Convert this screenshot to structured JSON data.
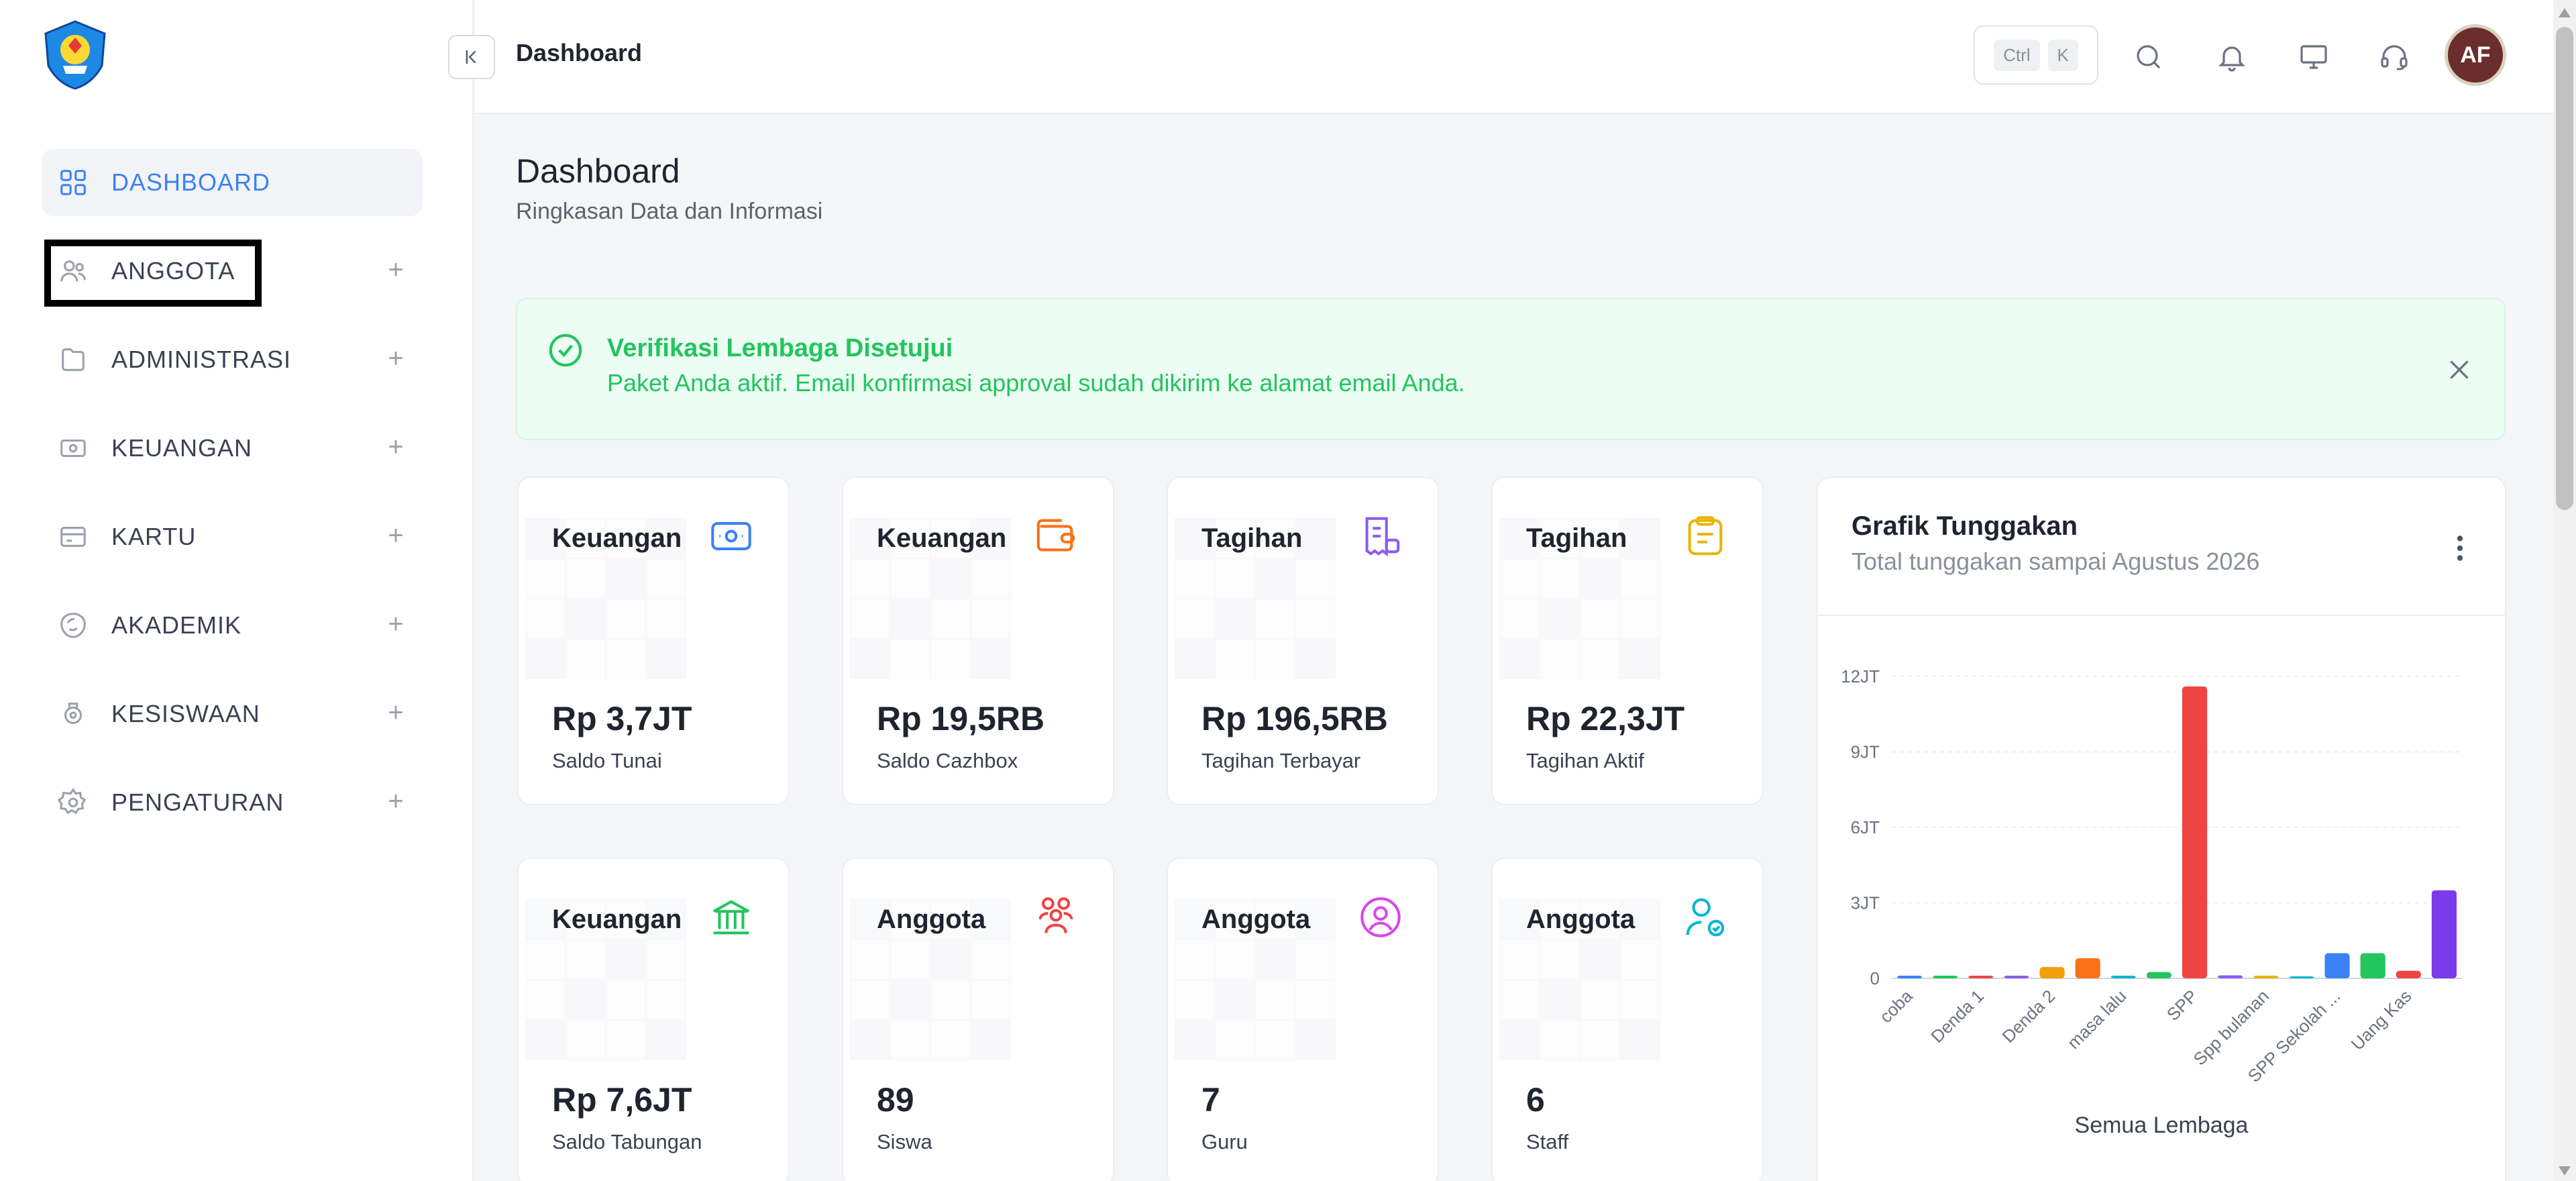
{
  "topbar": {
    "title": "Dashboard",
    "shortcut_keys": [
      "Ctrl",
      "K"
    ],
    "avatar_initials": "AF"
  },
  "sidebar": {
    "items": [
      {
        "label": "DASHBOARD",
        "icon": "dashboard-grid-icon",
        "active": true
      },
      {
        "label": "ANGGOTA",
        "icon": "users-icon"
      },
      {
        "label": "ADMINISTRASI",
        "icon": "folder-icon"
      },
      {
        "label": "KEUANGAN",
        "icon": "money-icon"
      },
      {
        "label": "KARTU",
        "icon": "card-icon"
      },
      {
        "label": "AKADEMIK",
        "icon": "academic-icon"
      },
      {
        "label": "KESISWAAN",
        "icon": "student-icon"
      },
      {
        "label": "PENGATURAN",
        "icon": "gear-icon"
      }
    ]
  },
  "main": {
    "title": "Dashboard",
    "subtitle": "Ringkasan Data dan Informasi",
    "alert": {
      "title": "Verifikasi Lembaga Disetujui",
      "text": "Paket Anda aktif. Email konfirmasi approval sudah dikirim ke alamat email Anda.",
      "color": "#22c55e"
    },
    "cards": [
      {
        "title": "Keuangan",
        "value": "Rp 3,7JT",
        "label": "Saldo Tunai",
        "icon": "cash-icon",
        "color": "#3b82f6"
      },
      {
        "title": "Keuangan",
        "value": "Rp 19,5RB",
        "label": "Saldo Cazhbox",
        "icon": "wallet-icon",
        "color": "#f97316"
      },
      {
        "title": "Tagihan",
        "value": "Rp 196,5RB",
        "label": "Tagihan Terbayar",
        "icon": "receipt-icon",
        "color": "#8b5cf6"
      },
      {
        "title": "Tagihan",
        "value": "Rp 22,3JT",
        "label": "Tagihan Aktif",
        "icon": "clipboard-icon",
        "color": "#eab308"
      },
      {
        "title": "Keuangan",
        "value": "Rp 7,6JT",
        "label": "Saldo Tabungan",
        "icon": "bank-icon",
        "color": "#22c55e"
      },
      {
        "title": "Anggota",
        "value": "89",
        "label": "Siswa",
        "icon": "group-icon",
        "color": "#ef4444"
      },
      {
        "title": "Anggota",
        "value": "7",
        "label": "Guru",
        "icon": "user-circle-icon",
        "color": "#d946ef"
      },
      {
        "title": "Anggota",
        "value": "6",
        "label": "Staff",
        "icon": "user-check-icon",
        "color": "#06b6d4"
      }
    ]
  },
  "chart": {
    "title": "Grafik Tunggakan",
    "subtitle": "Total tunggakan sampai Agustus 2026"
  },
  "chart_data": {
    "type": "bar",
    "xlabel": "Semua Lembaga",
    "ylabel": "",
    "ylim": [
      0,
      12000000
    ],
    "yticks": [
      0,
      3000000,
      6000000,
      9000000,
      12000000
    ],
    "ytick_labels": [
      "0",
      "3JT",
      "6JT",
      "9JT",
      "12JT"
    ],
    "grid": true,
    "categories": [
      "coba",
      "",
      "Denda 1",
      "",
      "Denda 2",
      "",
      "masa lalu",
      "",
      "SPP",
      "",
      "Spp bulanan",
      "",
      "SPP Sekolah ...",
      "",
      "Uang Kas"
    ],
    "values": [
      60000,
      60000,
      100000,
      60000,
      450000,
      800000,
      30000,
      250000,
      11600000,
      120000,
      60000,
      0,
      1000000,
      1000000,
      300000,
      3500000
    ],
    "bar_colors": [
      "#3b82f6",
      "#22c55e",
      "#ef4444",
      "#8b5cf6",
      "#f59e0b",
      "#f97316",
      "#06b6d4",
      "#22c55e",
      "#ef4444",
      "#8b5cf6",
      "#eab308",
      "#06b6d4",
      "#3b82f6",
      "#22c55e",
      "#ef4444",
      "#7c3aed"
    ],
    "tick_labels": [
      "coba",
      "Denda 1",
      "Denda 2",
      "masa lalu",
      "SPP",
      "Spp bulanan",
      "SPP Sekolah ...",
      "Uang Kas"
    ]
  }
}
